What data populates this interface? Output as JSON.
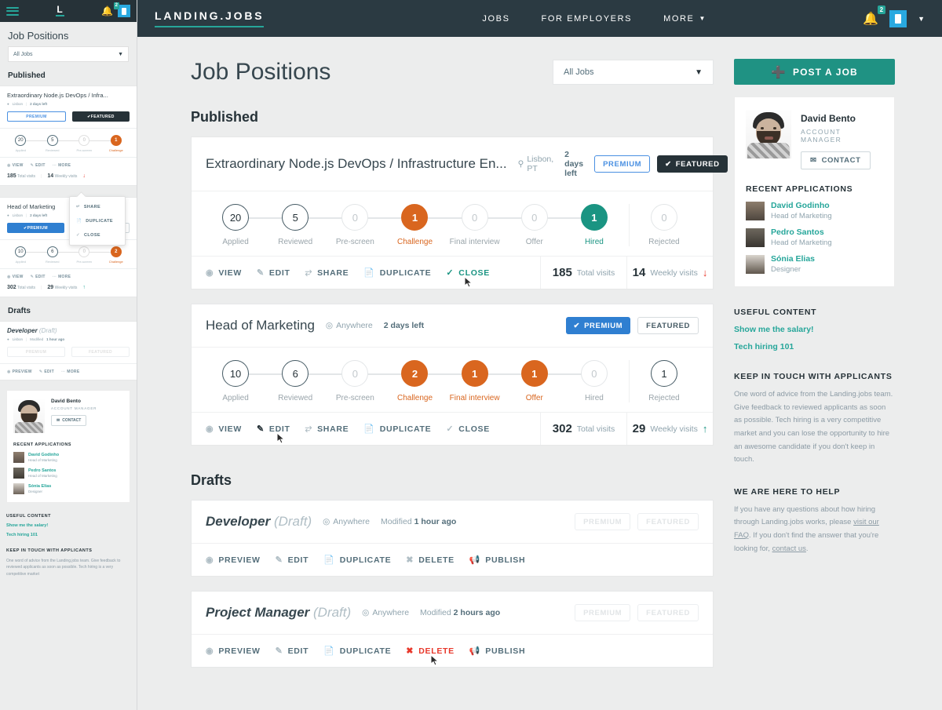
{
  "mobile": {
    "topbar": {
      "logo": "L",
      "bell_badge": "2"
    },
    "title": "Job Positions",
    "filter_value": "All Jobs",
    "published_heading": "Published",
    "drafts_heading": "Drafts",
    "cards": [
      {
        "title": "Extraordinary Node.js DevOps / Infra...",
        "location": "Lisbon",
        "days": "2 days left",
        "premium": "PREMIUM",
        "featured": "FEATURED",
        "stages": [
          {
            "label": "Applied",
            "value": "20"
          },
          {
            "label": "Reviewed",
            "value": "5"
          },
          {
            "label": "Pre-screen",
            "value": "0"
          },
          {
            "label": "Challenge",
            "value": "1"
          }
        ],
        "actions": [
          "VIEW",
          "EDIT",
          "MORE"
        ],
        "total_visits": "185",
        "total_visits_label": "Total visits",
        "weekly_visits": "14",
        "weekly_visits_label": "Weekly visits"
      },
      {
        "title": "Head of Marketing",
        "location": "Lisbon",
        "days": "2 days left",
        "premium": "PREMIUM",
        "featured": "FEATURED",
        "stages": [
          {
            "label": "Applied",
            "value": "10"
          },
          {
            "label": "Reviewed",
            "value": "6"
          },
          {
            "label": "Pre-screen",
            "value": "0"
          },
          {
            "label": "Challenge",
            "value": "2"
          }
        ],
        "actions": [
          "VIEW",
          "EDIT",
          "MORE"
        ],
        "total_visits": "302",
        "total_visits_label": "Total visits",
        "weekly_visits": "29",
        "weekly_visits_label": "Weekly visits"
      }
    ],
    "popup": [
      "SHARE",
      "DUPLICATE",
      "CLOSE"
    ],
    "draft": {
      "title": "Developer",
      "draft_tag": "(Draft)",
      "location": "Lisbon",
      "modified_prefix": "Modified",
      "modified": "1 hour ago",
      "premium": "PREMIUM",
      "featured": "FEATURED",
      "actions": [
        "PREVIEW",
        "EDIT",
        "MORE"
      ]
    },
    "widget": {
      "name": "David Bento",
      "role": "ACCOUNT MANAGER",
      "contact": "CONTACT",
      "recent_heading": "RECENT APPLICATIONS",
      "applications": [
        {
          "name": "David Godinho",
          "role": "Head of Marketing"
        },
        {
          "name": "Pedro Santos",
          "role": "Head of Marketing"
        },
        {
          "name": "Sónia Elias",
          "role": "Designer"
        }
      ]
    },
    "useful_heading": "USEFUL CONTENT",
    "useful_links": [
      "Show me the salary!",
      "Tech hiring 101"
    ],
    "keep_heading": "KEEP IN TOUCH WITH APPLICANTS",
    "keep_body": "One word of advice from the Landing.jobs team. Give feedback to reviewed applicants as soon as possible. Tech hiring is a very competitive market"
  },
  "topnav": {
    "brand": "LANDING.JOBS",
    "links": [
      "JOBS",
      "FOR EMPLOYERS",
      "MORE"
    ],
    "more_caret": "❯",
    "bell_badge": "2"
  },
  "header": {
    "page_title": "Job Positions",
    "filter_value": "All Jobs"
  },
  "sections": {
    "published": "Published",
    "drafts": "Drafts"
  },
  "published_jobs": [
    {
      "title": "Extraordinary Node.js DevOps / Infrastructure En...",
      "location": "Lisbon, PT",
      "location_icon": "pin-icon",
      "days_left": "2 days left",
      "premium_label": "PREMIUM",
      "premium_style": "outline",
      "featured_label": "FEATURED",
      "featured_style": "filled",
      "pipeline": [
        {
          "label": "Applied",
          "value": "20",
          "state": "normal"
        },
        {
          "label": "Reviewed",
          "value": "5",
          "state": "normal"
        },
        {
          "label": "Pre-screen",
          "value": "0",
          "state": "zero"
        },
        {
          "label": "Challenge",
          "value": "1",
          "state": "orange"
        },
        {
          "label": "Final interview",
          "value": "0",
          "state": "zero"
        },
        {
          "label": "Offer",
          "value": "0",
          "state": "zero"
        },
        {
          "label": "Hired",
          "value": "1",
          "state": "teal"
        }
      ],
      "rejected": {
        "label": "Rejected",
        "value": "0",
        "state": "zero"
      },
      "actions": [
        {
          "label": "VIEW",
          "icon": "eye-icon",
          "style": "normal"
        },
        {
          "label": "EDIT",
          "icon": "pencil-icon",
          "style": "normal"
        },
        {
          "label": "SHARE",
          "icon": "share-icon",
          "style": "normal"
        },
        {
          "label": "DUPLICATE",
          "icon": "copy-icon",
          "style": "normal"
        },
        {
          "label": "CLOSE",
          "icon": "check-icon",
          "style": "green"
        }
      ],
      "total_visits": "185",
      "total_visits_label": "Total visits",
      "weekly_visits": "14",
      "weekly_visits_label": "Weekly visits",
      "weekly_trend": "down"
    },
    {
      "title": "Head of Marketing",
      "location": "Anywhere",
      "location_icon": "remote-icon",
      "days_left": "2 days left",
      "premium_label": "PREMIUM",
      "premium_style": "filled",
      "featured_label": "FEATURED",
      "featured_style": "outline",
      "pipeline": [
        {
          "label": "Applied",
          "value": "10",
          "state": "normal"
        },
        {
          "label": "Reviewed",
          "value": "6",
          "state": "normal"
        },
        {
          "label": "Pre-screen",
          "value": "0",
          "state": "zero"
        },
        {
          "label": "Challenge",
          "value": "2",
          "state": "orange"
        },
        {
          "label": "Final interview",
          "value": "1",
          "state": "orange"
        },
        {
          "label": "Offer",
          "value": "1",
          "state": "orange"
        },
        {
          "label": "Hired",
          "value": "0",
          "state": "zero"
        }
      ],
      "rejected": {
        "label": "Rejected",
        "value": "1",
        "state": "normal"
      },
      "actions": [
        {
          "label": "VIEW",
          "icon": "eye-icon",
          "style": "normal"
        },
        {
          "label": "EDIT",
          "icon": "pencil-icon",
          "style": "dark"
        },
        {
          "label": "SHARE",
          "icon": "share-icon",
          "style": "normal"
        },
        {
          "label": "DUPLICATE",
          "icon": "copy-icon",
          "style": "normal"
        },
        {
          "label": "CLOSE",
          "icon": "check-icon",
          "style": "normal"
        }
      ],
      "total_visits": "302",
      "total_visits_label": "Total visits",
      "weekly_visits": "29",
      "weekly_visits_label": "Weekly visits",
      "weekly_trend": "up"
    }
  ],
  "draft_jobs": [
    {
      "title": "Developer",
      "draft_tag": "(Draft)",
      "location": "Anywhere",
      "modified_prefix": "Modified",
      "modified": "1 hour ago",
      "premium_label": "PREMIUM",
      "featured_label": "FEATURED",
      "actions": [
        {
          "label": "PREVIEW",
          "icon": "eye-icon",
          "style": "normal"
        },
        {
          "label": "EDIT",
          "icon": "pencil-icon",
          "style": "normal"
        },
        {
          "label": "DUPLICATE",
          "icon": "copy-icon",
          "style": "normal"
        },
        {
          "label": "DELETE",
          "icon": "x-icon",
          "style": "normal"
        },
        {
          "label": "PUBLISH",
          "icon": "megaphone-icon",
          "style": "normal"
        }
      ]
    },
    {
      "title": "Project Manager",
      "draft_tag": "(Draft)",
      "location": "Anywhere",
      "modified_prefix": "Modified",
      "modified": "2 hours ago",
      "premium_label": "PREMIUM",
      "featured_label": "FEATURED",
      "actions": [
        {
          "label": "PREVIEW",
          "icon": "eye-icon",
          "style": "normal"
        },
        {
          "label": "EDIT",
          "icon": "pencil-icon",
          "style": "normal"
        },
        {
          "label": "DUPLICATE",
          "icon": "copy-icon",
          "style": "normal"
        },
        {
          "label": "DELETE",
          "icon": "x-icon",
          "style": "red"
        },
        {
          "label": "PUBLISH",
          "icon": "megaphone-icon",
          "style": "normal"
        }
      ]
    }
  ],
  "sidebar": {
    "post_job": "POST A JOB",
    "manager": {
      "name": "David Bento",
      "role": "ACCOUNT MANAGER",
      "contact": "CONTACT"
    },
    "recent_heading": "RECENT APPLICATIONS",
    "applications": [
      {
        "name": "David Godinho",
        "role": "Head of Marketing"
      },
      {
        "name": "Pedro Santos",
        "role": "Head of Marketing"
      },
      {
        "name": "Sónia Elias",
        "role": "Designer"
      }
    ],
    "useful_heading": "USEFUL CONTENT",
    "useful_links": [
      "Show me the salary!",
      "Tech hiring 101"
    ],
    "keep_heading": "KEEP IN TOUCH WITH APPLICANTS",
    "keep_body": "One word of advice from the Landing.jobs team. Give feedback to reviewed applicants as soon as possible. Tech hiring is a very competitive market and you can lose the opportunity to hire an awesome candidate if you don't keep in touch.",
    "help_heading": "WE ARE HERE TO HELP",
    "help_body_1": "If you have any questions about how hiring through Landing.jobs works, please ",
    "help_link_1": "visit our FAQ",
    "help_body_2": ". If you don't find the answer that you're looking for, ",
    "help_link_2": "contact us",
    "help_body_3": "."
  },
  "colors": {
    "brand_teal": "#26a69a",
    "nav_dark": "#2b3a42",
    "orange": "#d9661f",
    "teal_filled": "#1a9482",
    "blue": "#2f7fd1",
    "red": "#e8372a",
    "page_bg": "#eceded"
  }
}
